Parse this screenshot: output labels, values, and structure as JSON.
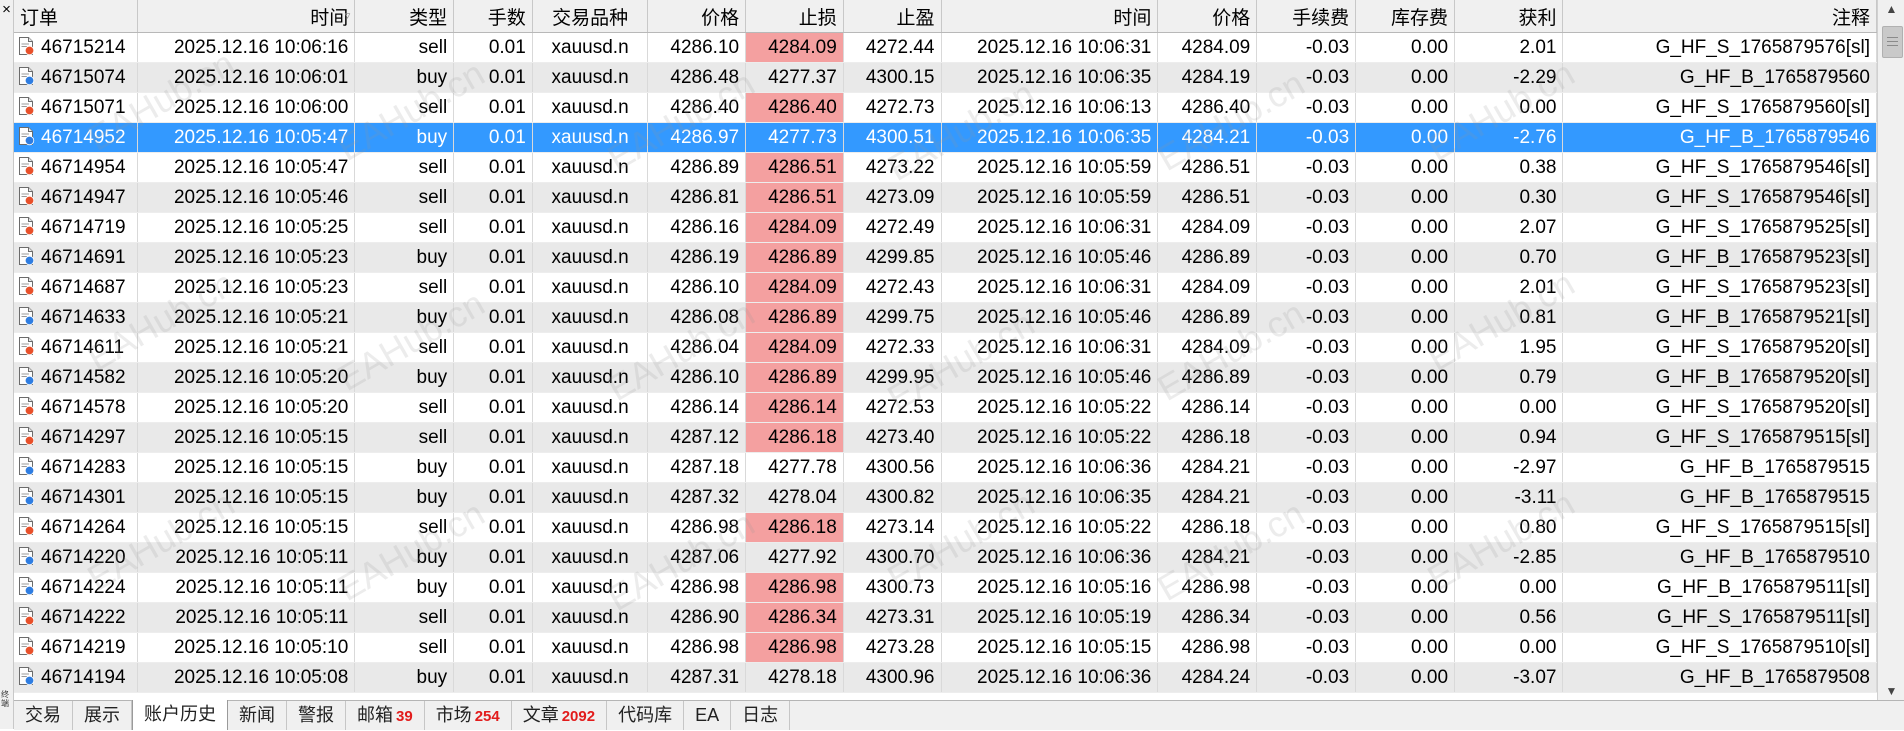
{
  "columns": [
    {
      "key": "order",
      "label": "订单",
      "align": "l"
    },
    {
      "key": "open_time",
      "label": "时间",
      "align": "r",
      "sorted": true
    },
    {
      "key": "type",
      "label": "类型",
      "align": "r"
    },
    {
      "key": "lots",
      "label": "手数",
      "align": "r"
    },
    {
      "key": "symbol",
      "label": "交易品种",
      "align": "c"
    },
    {
      "key": "open_price",
      "label": "价格",
      "align": "r"
    },
    {
      "key": "sl",
      "label": "止损",
      "align": "r"
    },
    {
      "key": "tp",
      "label": "止盈",
      "align": "r"
    },
    {
      "key": "close_time",
      "label": "时间",
      "align": "r"
    },
    {
      "key": "close_price",
      "label": "价格",
      "align": "r"
    },
    {
      "key": "commission",
      "label": "手续费",
      "align": "r"
    },
    {
      "key": "swap",
      "label": "库存费",
      "align": "r"
    },
    {
      "key": "profit",
      "label": "获利",
      "align": "r"
    },
    {
      "key": "comment",
      "label": "注释",
      "align": "r"
    }
  ],
  "rows": [
    {
      "order": "46715214",
      "open_time": "2025.12.16 10:06:16",
      "type": "sell",
      "lots": "0.01",
      "symbol": "xauusd.n",
      "open_price": "4286.10",
      "sl": "4284.09",
      "tp": "4272.44",
      "close_time": "2025.12.16 10:06:31",
      "close_price": "4284.09",
      "commission": "-0.03",
      "swap": "0.00",
      "profit": "2.01",
      "comment": "G_HF_S_1765879576[sl]",
      "sl_hit": true
    },
    {
      "order": "46715074",
      "open_time": "2025.12.16 10:06:01",
      "type": "buy",
      "lots": "0.01",
      "symbol": "xauusd.n",
      "open_price": "4286.48",
      "sl": "4277.37",
      "tp": "4300.15",
      "close_time": "2025.12.16 10:06:35",
      "close_price": "4284.19",
      "commission": "-0.03",
      "swap": "0.00",
      "profit": "-2.29",
      "comment": "G_HF_B_1765879560",
      "sl_hit": false
    },
    {
      "order": "46715071",
      "open_time": "2025.12.16 10:06:00",
      "type": "sell",
      "lots": "0.01",
      "symbol": "xauusd.n",
      "open_price": "4286.40",
      "sl": "4286.40",
      "tp": "4272.73",
      "close_time": "2025.12.16 10:06:13",
      "close_price": "4286.40",
      "commission": "-0.03",
      "swap": "0.00",
      "profit": "0.00",
      "comment": "G_HF_S_1765879560[sl]",
      "sl_hit": true
    },
    {
      "order": "46714952",
      "open_time": "2025.12.16 10:05:47",
      "type": "buy",
      "lots": "0.01",
      "symbol": "xauusd.n",
      "open_price": "4286.97",
      "sl": "4277.73",
      "tp": "4300.51",
      "close_time": "2025.12.16 10:06:35",
      "close_price": "4284.21",
      "commission": "-0.03",
      "swap": "0.00",
      "profit": "-2.76",
      "comment": "G_HF_B_1765879546",
      "sl_hit": false,
      "selected": true
    },
    {
      "order": "46714954",
      "open_time": "2025.12.16 10:05:47",
      "type": "sell",
      "lots": "0.01",
      "symbol": "xauusd.n",
      "open_price": "4286.89",
      "sl": "4286.51",
      "tp": "4273.22",
      "close_time": "2025.12.16 10:05:59",
      "close_price": "4286.51",
      "commission": "-0.03",
      "swap": "0.00",
      "profit": "0.38",
      "comment": "G_HF_S_1765879546[sl]",
      "sl_hit": true
    },
    {
      "order": "46714947",
      "open_time": "2025.12.16 10:05:46",
      "type": "sell",
      "lots": "0.01",
      "symbol": "xauusd.n",
      "open_price": "4286.81",
      "sl": "4286.51",
      "tp": "4273.09",
      "close_time": "2025.12.16 10:05:59",
      "close_price": "4286.51",
      "commission": "-0.03",
      "swap": "0.00",
      "profit": "0.30",
      "comment": "G_HF_S_1765879546[sl]",
      "sl_hit": true
    },
    {
      "order": "46714719",
      "open_time": "2025.12.16 10:05:25",
      "type": "sell",
      "lots": "0.01",
      "symbol": "xauusd.n",
      "open_price": "4286.16",
      "sl": "4284.09",
      "tp": "4272.49",
      "close_time": "2025.12.16 10:06:31",
      "close_price": "4284.09",
      "commission": "-0.03",
      "swap": "0.00",
      "profit": "2.07",
      "comment": "G_HF_S_1765879525[sl]",
      "sl_hit": true
    },
    {
      "order": "46714691",
      "open_time": "2025.12.16 10:05:23",
      "type": "buy",
      "lots": "0.01",
      "symbol": "xauusd.n",
      "open_price": "4286.19",
      "sl": "4286.89",
      "tp": "4299.85",
      "close_time": "2025.12.16 10:05:46",
      "close_price": "4286.89",
      "commission": "-0.03",
      "swap": "0.00",
      "profit": "0.70",
      "comment": "G_HF_B_1765879523[sl]",
      "sl_hit": true
    },
    {
      "order": "46714687",
      "open_time": "2025.12.16 10:05:23",
      "type": "sell",
      "lots": "0.01",
      "symbol": "xauusd.n",
      "open_price": "4286.10",
      "sl": "4284.09",
      "tp": "4272.43",
      "close_time": "2025.12.16 10:06:31",
      "close_price": "4284.09",
      "commission": "-0.03",
      "swap": "0.00",
      "profit": "2.01",
      "comment": "G_HF_S_1765879523[sl]",
      "sl_hit": true
    },
    {
      "order": "46714633",
      "open_time": "2025.12.16 10:05:21",
      "type": "buy",
      "lots": "0.01",
      "symbol": "xauusd.n",
      "open_price": "4286.08",
      "sl": "4286.89",
      "tp": "4299.75",
      "close_time": "2025.12.16 10:05:46",
      "close_price": "4286.89",
      "commission": "-0.03",
      "swap": "0.00",
      "profit": "0.81",
      "comment": "G_HF_B_1765879521[sl]",
      "sl_hit": true
    },
    {
      "order": "46714611",
      "open_time": "2025.12.16 10:05:21",
      "type": "sell",
      "lots": "0.01",
      "symbol": "xauusd.n",
      "open_price": "4286.04",
      "sl": "4284.09",
      "tp": "4272.33",
      "close_time": "2025.12.16 10:06:31",
      "close_price": "4284.09",
      "commission": "-0.03",
      "swap": "0.00",
      "profit": "1.95",
      "comment": "G_HF_S_1765879520[sl]",
      "sl_hit": true
    },
    {
      "order": "46714582",
      "open_time": "2025.12.16 10:05:20",
      "type": "buy",
      "lots": "0.01",
      "symbol": "xauusd.n",
      "open_price": "4286.10",
      "sl": "4286.89",
      "tp": "4299.95",
      "close_time": "2025.12.16 10:05:46",
      "close_price": "4286.89",
      "commission": "-0.03",
      "swap": "0.00",
      "profit": "0.79",
      "comment": "G_HF_B_1765879520[sl]",
      "sl_hit": true
    },
    {
      "order": "46714578",
      "open_time": "2025.12.16 10:05:20",
      "type": "sell",
      "lots": "0.01",
      "symbol": "xauusd.n",
      "open_price": "4286.14",
      "sl": "4286.14",
      "tp": "4272.53",
      "close_time": "2025.12.16 10:05:22",
      "close_price": "4286.14",
      "commission": "-0.03",
      "swap": "0.00",
      "profit": "0.00",
      "comment": "G_HF_S_1765879520[sl]",
      "sl_hit": true
    },
    {
      "order": "46714297",
      "open_time": "2025.12.16 10:05:15",
      "type": "sell",
      "lots": "0.01",
      "symbol": "xauusd.n",
      "open_price": "4287.12",
      "sl": "4286.18",
      "tp": "4273.40",
      "close_time": "2025.12.16 10:05:22",
      "close_price": "4286.18",
      "commission": "-0.03",
      "swap": "0.00",
      "profit": "0.94",
      "comment": "G_HF_S_1765879515[sl]",
      "sl_hit": true
    },
    {
      "order": "46714283",
      "open_time": "2025.12.16 10:05:15",
      "type": "buy",
      "lots": "0.01",
      "symbol": "xauusd.n",
      "open_price": "4287.18",
      "sl": "4277.78",
      "tp": "4300.56",
      "close_time": "2025.12.16 10:06:36",
      "close_price": "4284.21",
      "commission": "-0.03",
      "swap": "0.00",
      "profit": "-2.97",
      "comment": "G_HF_B_1765879515",
      "sl_hit": false
    },
    {
      "order": "46714301",
      "open_time": "2025.12.16 10:05:15",
      "type": "buy",
      "lots": "0.01",
      "symbol": "xauusd.n",
      "open_price": "4287.32",
      "sl": "4278.04",
      "tp": "4300.82",
      "close_time": "2025.12.16 10:06:35",
      "close_price": "4284.21",
      "commission": "-0.03",
      "swap": "0.00",
      "profit": "-3.11",
      "comment": "G_HF_B_1765879515",
      "sl_hit": false
    },
    {
      "order": "46714264",
      "open_time": "2025.12.16 10:05:15",
      "type": "sell",
      "lots": "0.01",
      "symbol": "xauusd.n",
      "open_price": "4286.98",
      "sl": "4286.18",
      "tp": "4273.14",
      "close_time": "2025.12.16 10:05:22",
      "close_price": "4286.18",
      "commission": "-0.03",
      "swap": "0.00",
      "profit": "0.80",
      "comment": "G_HF_S_1765879515[sl]",
      "sl_hit": true
    },
    {
      "order": "46714220",
      "open_time": "2025.12.16 10:05:11",
      "type": "buy",
      "lots": "0.01",
      "symbol": "xauusd.n",
      "open_price": "4287.06",
      "sl": "4277.92",
      "tp": "4300.70",
      "close_time": "2025.12.16 10:06:36",
      "close_price": "4284.21",
      "commission": "-0.03",
      "swap": "0.00",
      "profit": "-2.85",
      "comment": "G_HF_B_1765879510",
      "sl_hit": false
    },
    {
      "order": "46714224",
      "open_time": "2025.12.16 10:05:11",
      "type": "buy",
      "lots": "0.01",
      "symbol": "xauusd.n",
      "open_price": "4286.98",
      "sl": "4286.98",
      "tp": "4300.73",
      "close_time": "2025.12.16 10:05:16",
      "close_price": "4286.98",
      "commission": "-0.03",
      "swap": "0.00",
      "profit": "0.00",
      "comment": "G_HF_B_1765879511[sl]",
      "sl_hit": true
    },
    {
      "order": "46714222",
      "open_time": "2025.12.16 10:05:11",
      "type": "sell",
      "lots": "0.01",
      "symbol": "xauusd.n",
      "open_price": "4286.90",
      "sl": "4286.34",
      "tp": "4273.31",
      "close_time": "2025.12.16 10:05:19",
      "close_price": "4286.34",
      "commission": "-0.03",
      "swap": "0.00",
      "profit": "0.56",
      "comment": "G_HF_S_1765879511[sl]",
      "sl_hit": true
    },
    {
      "order": "46714219",
      "open_time": "2025.12.16 10:05:10",
      "type": "sell",
      "lots": "0.01",
      "symbol": "xauusd.n",
      "open_price": "4286.98",
      "sl": "4286.98",
      "tp": "4273.28",
      "close_time": "2025.12.16 10:05:15",
      "close_price": "4286.98",
      "commission": "-0.03",
      "swap": "0.00",
      "profit": "0.00",
      "comment": "G_HF_S_1765879510[sl]",
      "sl_hit": true
    },
    {
      "order": "46714194",
      "open_time": "2025.12.16 10:05:08",
      "type": "buy",
      "lots": "0.01",
      "symbol": "xauusd.n",
      "open_price": "4287.31",
      "sl": "4278.18",
      "tp": "4300.96",
      "close_time": "2025.12.16 10:06:36",
      "close_price": "4284.24",
      "commission": "-0.03",
      "swap": "0.00",
      "profit": "-3.07",
      "comment": "G_HF_B_1765879508",
      "sl_hit": false
    }
  ],
  "tabs": [
    {
      "name": "tab-trade",
      "label": "交易",
      "badge": ""
    },
    {
      "name": "tab-exposure",
      "label": "展示",
      "badge": ""
    },
    {
      "name": "tab-account-history",
      "label": "账户历史",
      "badge": "",
      "active": true
    },
    {
      "name": "tab-news",
      "label": "新闻",
      "badge": ""
    },
    {
      "name": "tab-alerts",
      "label": "警报",
      "badge": ""
    },
    {
      "name": "tab-mailbox",
      "label": "邮箱",
      "badge": "39"
    },
    {
      "name": "tab-market",
      "label": "市场",
      "badge": "254"
    },
    {
      "name": "tab-articles",
      "label": "文章",
      "badge": "2092"
    },
    {
      "name": "tab-code-base",
      "label": "代码库",
      "badge": ""
    },
    {
      "name": "tab-ea",
      "label": "EA",
      "badge": ""
    },
    {
      "name": "tab-journal",
      "label": "日志",
      "badge": ""
    }
  ],
  "left_strip": {
    "close_glyph": "×",
    "vertical_label": "终端"
  },
  "watermark": "EAHub.cn",
  "icons": {
    "sell": "sell-order-icon",
    "buy": "buy-order-icon"
  },
  "colors": {
    "selected_row": "#3399ff",
    "sl_hit_cell": "#f4a0a0",
    "sell_icon_badge": "#e8502a",
    "buy_icon_badge": "#2f7de1",
    "badge_text": "#e21b1b"
  }
}
